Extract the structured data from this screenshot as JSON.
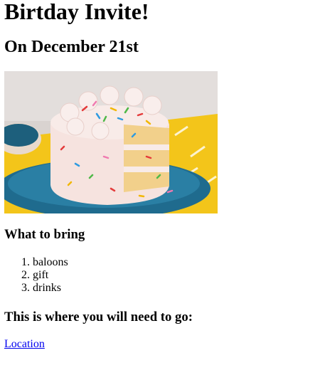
{
  "title": "Birtday Invite!",
  "subtitle": "On December 21st",
  "image": {
    "subject": "cake-image"
  },
  "bring": {
    "heading": "What to bring",
    "items": [
      "baloons",
      "gift",
      "drinks"
    ]
  },
  "where": {
    "heading": "This is where you will need to go:",
    "link_label": "Location"
  },
  "colors": {
    "link": "#0000ee",
    "background": "#ffffff"
  }
}
